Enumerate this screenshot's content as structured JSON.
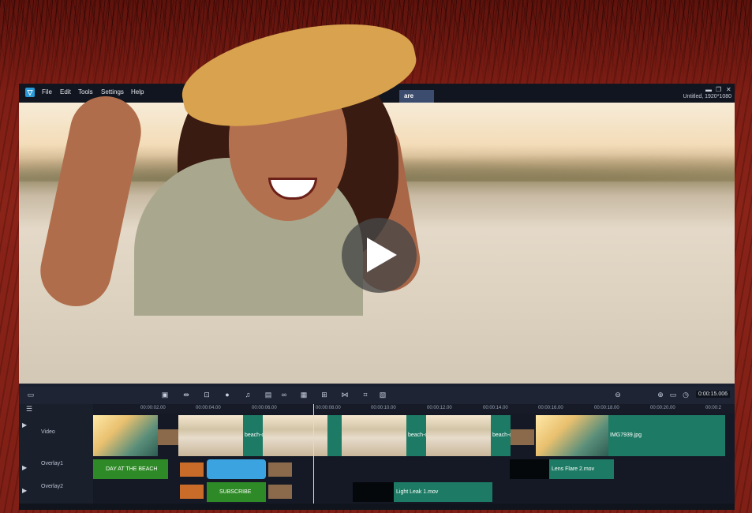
{
  "menu": {
    "file": "File",
    "edit": "Edit",
    "tools": "Tools",
    "settings": "Settings",
    "help": "Help"
  },
  "tabs": {
    "share": "are"
  },
  "project": {
    "info": "Untitled, 1920*1080"
  },
  "timecode": "0:00:15.006",
  "ruler": [
    "00:00:02.00",
    "00:00:04.00",
    "00:00:06.00",
    "00:00:08.00",
    "00:00:10.00",
    "00:00:12.00",
    "00:00:14.00",
    "00:00:16.00",
    "00:00:18.00",
    "00:00:20.00",
    "00:00:2"
  ],
  "tracks": {
    "video": {
      "name": "Video",
      "clips": [
        "beach-c",
        "beach-c",
        "beach-c",
        "IMG7939.jpg"
      ]
    },
    "overlay1": {
      "name": "Overlay1",
      "title": "DAY AT THE BEACH",
      "lens": "Lens Flare 2.mov"
    },
    "overlay2": {
      "name": "Overlay2",
      "subscribe": "SUBSCRIBE",
      "leak": "Light Leak 1.mov"
    }
  },
  "colors": {
    "accent": "#3b4c6e",
    "clip_green": "#1d7a64",
    "clip_lime": "#2e8a26",
    "clip_blue": "#3aa3e0"
  }
}
